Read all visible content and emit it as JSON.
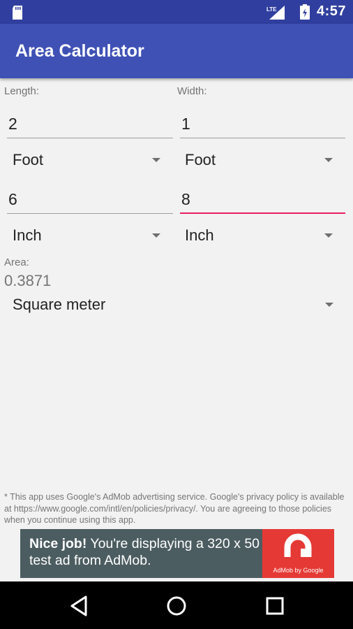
{
  "status_bar": {
    "time": "4:57",
    "network_label": "LTE"
  },
  "app_bar": {
    "title": "Area Calculator"
  },
  "length": {
    "label": "Length:",
    "value1": "2",
    "unit1": "Foot",
    "value2": "6",
    "unit2": "Inch"
  },
  "width": {
    "label": "Width:",
    "value1": "1",
    "unit1": "Foot",
    "value2": "8",
    "unit2": "Inch"
  },
  "area": {
    "label": "Area:",
    "value": "0.3871",
    "unit": "Square meter"
  },
  "disclaimer": "* This app uses Google's AdMob advertising service. Google's privacy policy is available at https://www.google.com/intl/en/policies/privacy/. You are agreeing to those policies when you continue using this app.",
  "ad": {
    "headline": "Nice job!",
    "body": "You're displaying a 320 x 50 test ad from AdMob.",
    "brand": "AdMob by Google"
  },
  "colors": {
    "status_bar": "#303f9f",
    "app_bar": "#3f51b5",
    "accent": "#e91e63",
    "ad_background": "#4c5d61",
    "ad_logo": "#e53935"
  },
  "icons": [
    "sd-card-icon",
    "signal-icon",
    "battery-icon",
    "back-icon",
    "home-icon",
    "recents-icon",
    "dropdown-arrow-icon",
    "admob-logo-icon"
  ]
}
